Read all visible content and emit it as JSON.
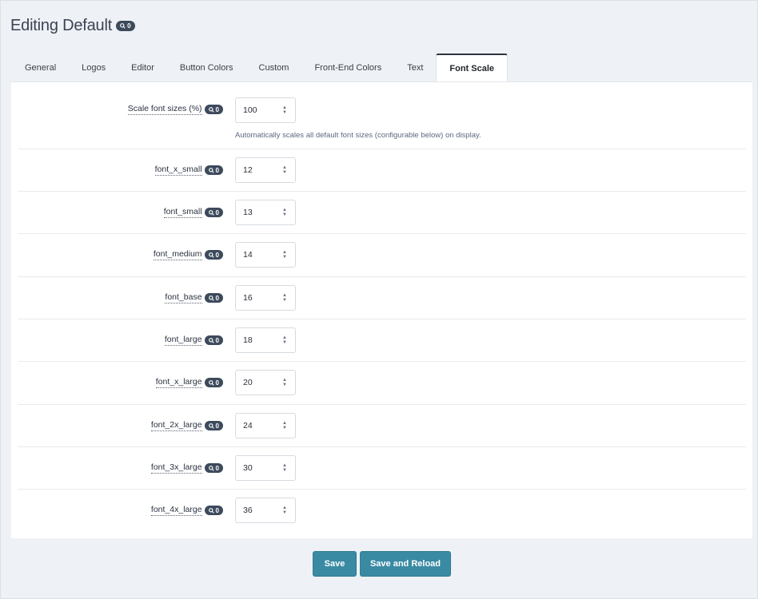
{
  "header": {
    "title": "Editing Default",
    "badge_count": "0"
  },
  "tabs": [
    {
      "label": "General"
    },
    {
      "label": "Logos"
    },
    {
      "label": "Editor"
    },
    {
      "label": "Button Colors"
    },
    {
      "label": "Custom"
    },
    {
      "label": "Front-End Colors"
    },
    {
      "label": "Text"
    },
    {
      "label": "Font Scale",
      "active": true
    }
  ],
  "fields": [
    {
      "label": "Scale font sizes (%)",
      "value": "100",
      "badge": "0",
      "help": "Automatically scales all default font sizes (configurable below) on display."
    },
    {
      "label": "font_x_small",
      "value": "12",
      "badge": "0"
    },
    {
      "label": "font_small",
      "value": "13",
      "badge": "0"
    },
    {
      "label": "font_medium",
      "value": "14",
      "badge": "0"
    },
    {
      "label": "font_base",
      "value": "16",
      "badge": "0"
    },
    {
      "label": "font_large",
      "value": "18",
      "badge": "0"
    },
    {
      "label": "font_x_large",
      "value": "20",
      "badge": "0"
    },
    {
      "label": "font_2x_large",
      "value": "24",
      "badge": "0"
    },
    {
      "label": "font_3x_large",
      "value": "30",
      "badge": "0"
    },
    {
      "label": "font_4x_large",
      "value": "36",
      "badge": "0"
    }
  ],
  "footer": {
    "save_label": "Save",
    "save_reload_label": "Save and Reload"
  },
  "colors": {
    "accent": "#3a8aa3",
    "badge": "#3d4a5c"
  }
}
